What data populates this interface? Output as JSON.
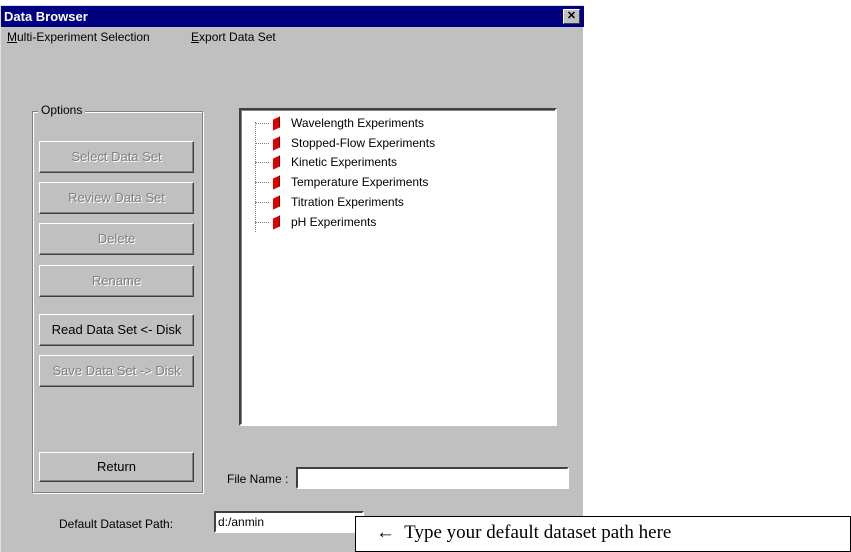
{
  "window": {
    "title": "Data Browser",
    "close_icon": "close-icon"
  },
  "menu": {
    "items": [
      {
        "label": "Multi-Experiment Selection",
        "mnemonic": "M"
      },
      {
        "label": "Export Data Set",
        "mnemonic": "E"
      }
    ]
  },
  "options": {
    "label": "Options",
    "buttons": [
      {
        "label": "Select Data Set",
        "enabled": false
      },
      {
        "label": "Review Data Set",
        "enabled": false
      },
      {
        "label": "Delete",
        "enabled": false
      },
      {
        "label": "Rename",
        "enabled": false
      },
      {
        "label": "Read Data Set <- Disk",
        "enabled": true
      },
      {
        "label": "Save Data Set -> Disk",
        "enabled": false
      }
    ],
    "return_label": "Return"
  },
  "tree": {
    "items": [
      {
        "label": "Wavelength Experiments",
        "icon": "book-icon"
      },
      {
        "label": "Stopped-Flow Experiments",
        "icon": "book-icon"
      },
      {
        "label": "Kinetic Experiments",
        "icon": "book-icon"
      },
      {
        "label": "Temperature Experiments",
        "icon": "book-icon"
      },
      {
        "label": "Titration Experiments",
        "icon": "book-icon"
      },
      {
        "label": "pH Experiments",
        "icon": "book-icon"
      }
    ]
  },
  "file_name": {
    "label": "File Name :",
    "value": ""
  },
  "default_path": {
    "label": "Default Dataset Path:",
    "value": "d:/anmin"
  },
  "callout": {
    "arrow": "←",
    "text": "Type your default dataset path here"
  }
}
